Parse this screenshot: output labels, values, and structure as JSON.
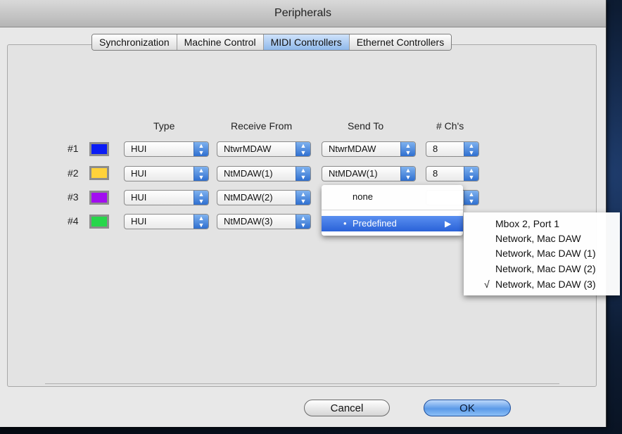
{
  "window": {
    "title": "Peripherals"
  },
  "tabs": [
    {
      "label": "Synchronization",
      "active": false
    },
    {
      "label": "Machine Control",
      "active": false
    },
    {
      "label": "MIDI Controllers",
      "active": true
    },
    {
      "label": "Ethernet Controllers",
      "active": false
    }
  ],
  "columns": {
    "type": "Type",
    "receive": "Receive From",
    "send": "Send To",
    "channels": "# Ch's"
  },
  "rows": [
    {
      "label": "#1",
      "color": "#0a1cf5",
      "type": "HUI",
      "receive": "NtwrMDAW",
      "send": "NtwrMDAW",
      "channels": "8"
    },
    {
      "label": "#2",
      "color": "#ffd23a",
      "type": "HUI",
      "receive": "NtMDAW(1)",
      "send": "NtMDAW(1)",
      "channels": "8"
    },
    {
      "label": "#3",
      "color": "#a20df0",
      "type": "HUI",
      "receive": "NtMDAW(2)",
      "send": "",
      "channels": ""
    },
    {
      "label": "#4",
      "color": "#27d64a",
      "type": "HUI",
      "receive": "NtMDAW(3)",
      "send": "",
      "channels": ""
    }
  ],
  "send_menu": {
    "none_label": "none",
    "predefined_label": "Predefined",
    "submenu_arrow": "▶",
    "bullet": "•"
  },
  "submenu": {
    "items": [
      "Mbox 2, Port 1",
      "Network, Mac DAW",
      "Network, Mac DAW (1)",
      "Network, Mac DAW (2)",
      "Network, Mac DAW (3)"
    ],
    "checked": "√"
  },
  "buttons": {
    "cancel": "Cancel",
    "ok": "OK"
  },
  "icons": {
    "popup_arrows": "updown-arrows-icon"
  }
}
